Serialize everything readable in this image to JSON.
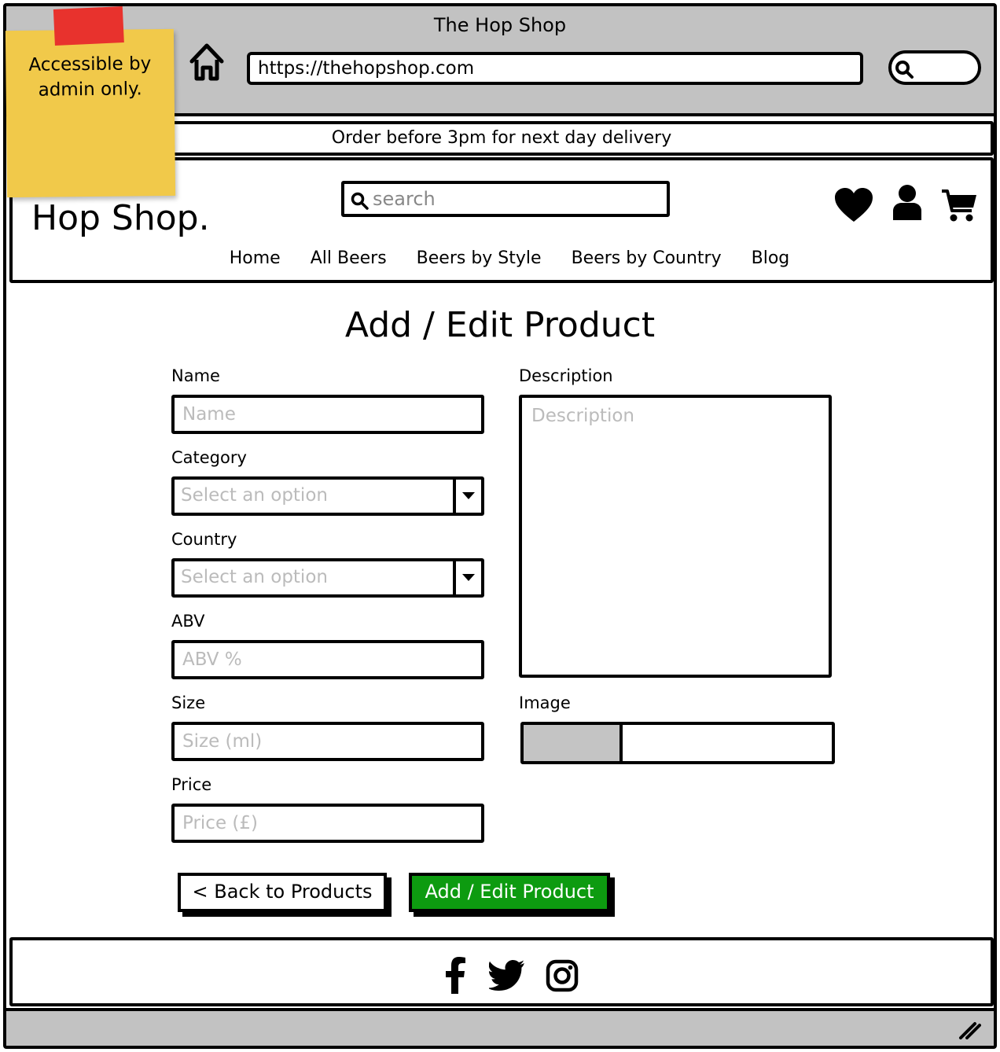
{
  "browser": {
    "title": "The Hop Shop",
    "url": "https://thehopshop.com"
  },
  "sticky_note": {
    "line1": "Accessible by",
    "line2": "admin only."
  },
  "banner": {
    "text": "Order before 3pm for next day delivery"
  },
  "header": {
    "logo": "Hop Shop.",
    "search_placeholder": "search",
    "nav": [
      "Home",
      "All Beers",
      "Beers by Style",
      "Beers by Country",
      "Blog"
    ]
  },
  "page": {
    "title": "Add / Edit Product"
  },
  "form": {
    "name": {
      "label": "Name",
      "placeholder": "Name"
    },
    "category": {
      "label": "Category",
      "selected": "Select an option"
    },
    "country": {
      "label": "Country",
      "selected": "Select an option"
    },
    "abv": {
      "label": "ABV",
      "placeholder": "ABV %"
    },
    "size": {
      "label": "Size",
      "placeholder": "Size (ml)"
    },
    "price": {
      "label": "Price",
      "placeholder": "Price (£)"
    },
    "description": {
      "label": "Description",
      "placeholder": "Description"
    },
    "image": {
      "label": "Image"
    },
    "back_label": "< Back to Products",
    "submit_label": "Add / Edit Product",
    "submit_color": "#0d9b10"
  },
  "footer": {
    "icons": [
      "facebook-icon",
      "twitter-icon",
      "instagram-icon"
    ]
  }
}
